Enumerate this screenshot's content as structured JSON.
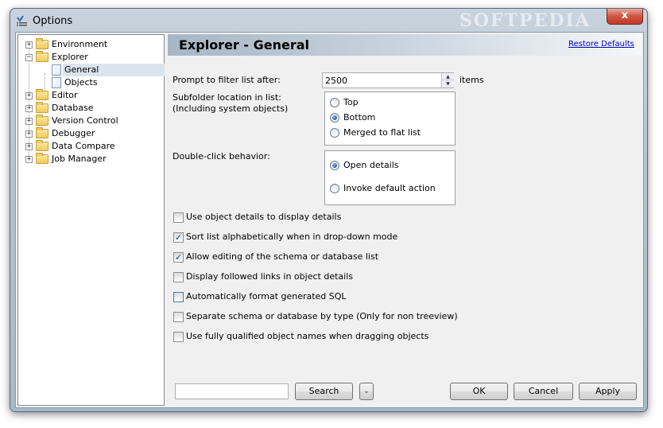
{
  "window": {
    "title": "Options",
    "watermark": "SOFTPEDIA",
    "close_label": "x"
  },
  "tree": {
    "items": [
      {
        "label": "Environment",
        "expander": "+"
      },
      {
        "label": "Explorer",
        "expander": "−"
      },
      {
        "label": "General"
      },
      {
        "label": "Objects"
      },
      {
        "label": "Editor",
        "expander": "+"
      },
      {
        "label": "Database",
        "expander": "+"
      },
      {
        "label": "Version Control",
        "expander": "+"
      },
      {
        "label": "Debugger",
        "expander": "+"
      },
      {
        "label": "Data Compare",
        "expander": "+"
      },
      {
        "label": "Job Manager",
        "expander": "+"
      }
    ],
    "selected": "General"
  },
  "panel": {
    "title": "Explorer - General",
    "restore_link": "Restore Defaults",
    "prompt_label": "Prompt to filter list after:",
    "prompt_value": "2500",
    "prompt_unit": "items",
    "subfolder_label_1": "Subfolder location in list:",
    "subfolder_label_2": "(Including system objects)",
    "subfolder_options": [
      {
        "label": "Top",
        "checked": false
      },
      {
        "label": "Bottom",
        "checked": true
      },
      {
        "label": "Merged to flat list",
        "checked": false
      }
    ],
    "dblclick_label": "Double-click behavior:",
    "dblclick_options": [
      {
        "label": "Open details",
        "checked": true
      },
      {
        "label": "Invoke default action",
        "checked": false
      }
    ],
    "checkboxes": [
      {
        "label": "Use object details to display details",
        "checked": false
      },
      {
        "label": "Sort list alphabetically when in drop-down mode",
        "checked": true
      },
      {
        "label": "Allow editing of the schema or database list",
        "checked": true
      },
      {
        "label": "Display followed links in object details",
        "checked": false
      },
      {
        "label": "Automatically format generated SQL",
        "checked": false
      },
      {
        "label": "Separate schema or database by type (Only for non treeview)",
        "checked": false
      },
      {
        "label": "Use fully qualified object names when dragging objects",
        "checked": false
      }
    ]
  },
  "footer": {
    "search_value": "",
    "search_button": "Search",
    "ok_button": "OK",
    "cancel_button": "Cancel",
    "apply_button": "Apply"
  },
  "colors": {
    "header_gradient_start": "#a7b6c5",
    "link": "#0000cc",
    "check": "#1c3f7a"
  }
}
